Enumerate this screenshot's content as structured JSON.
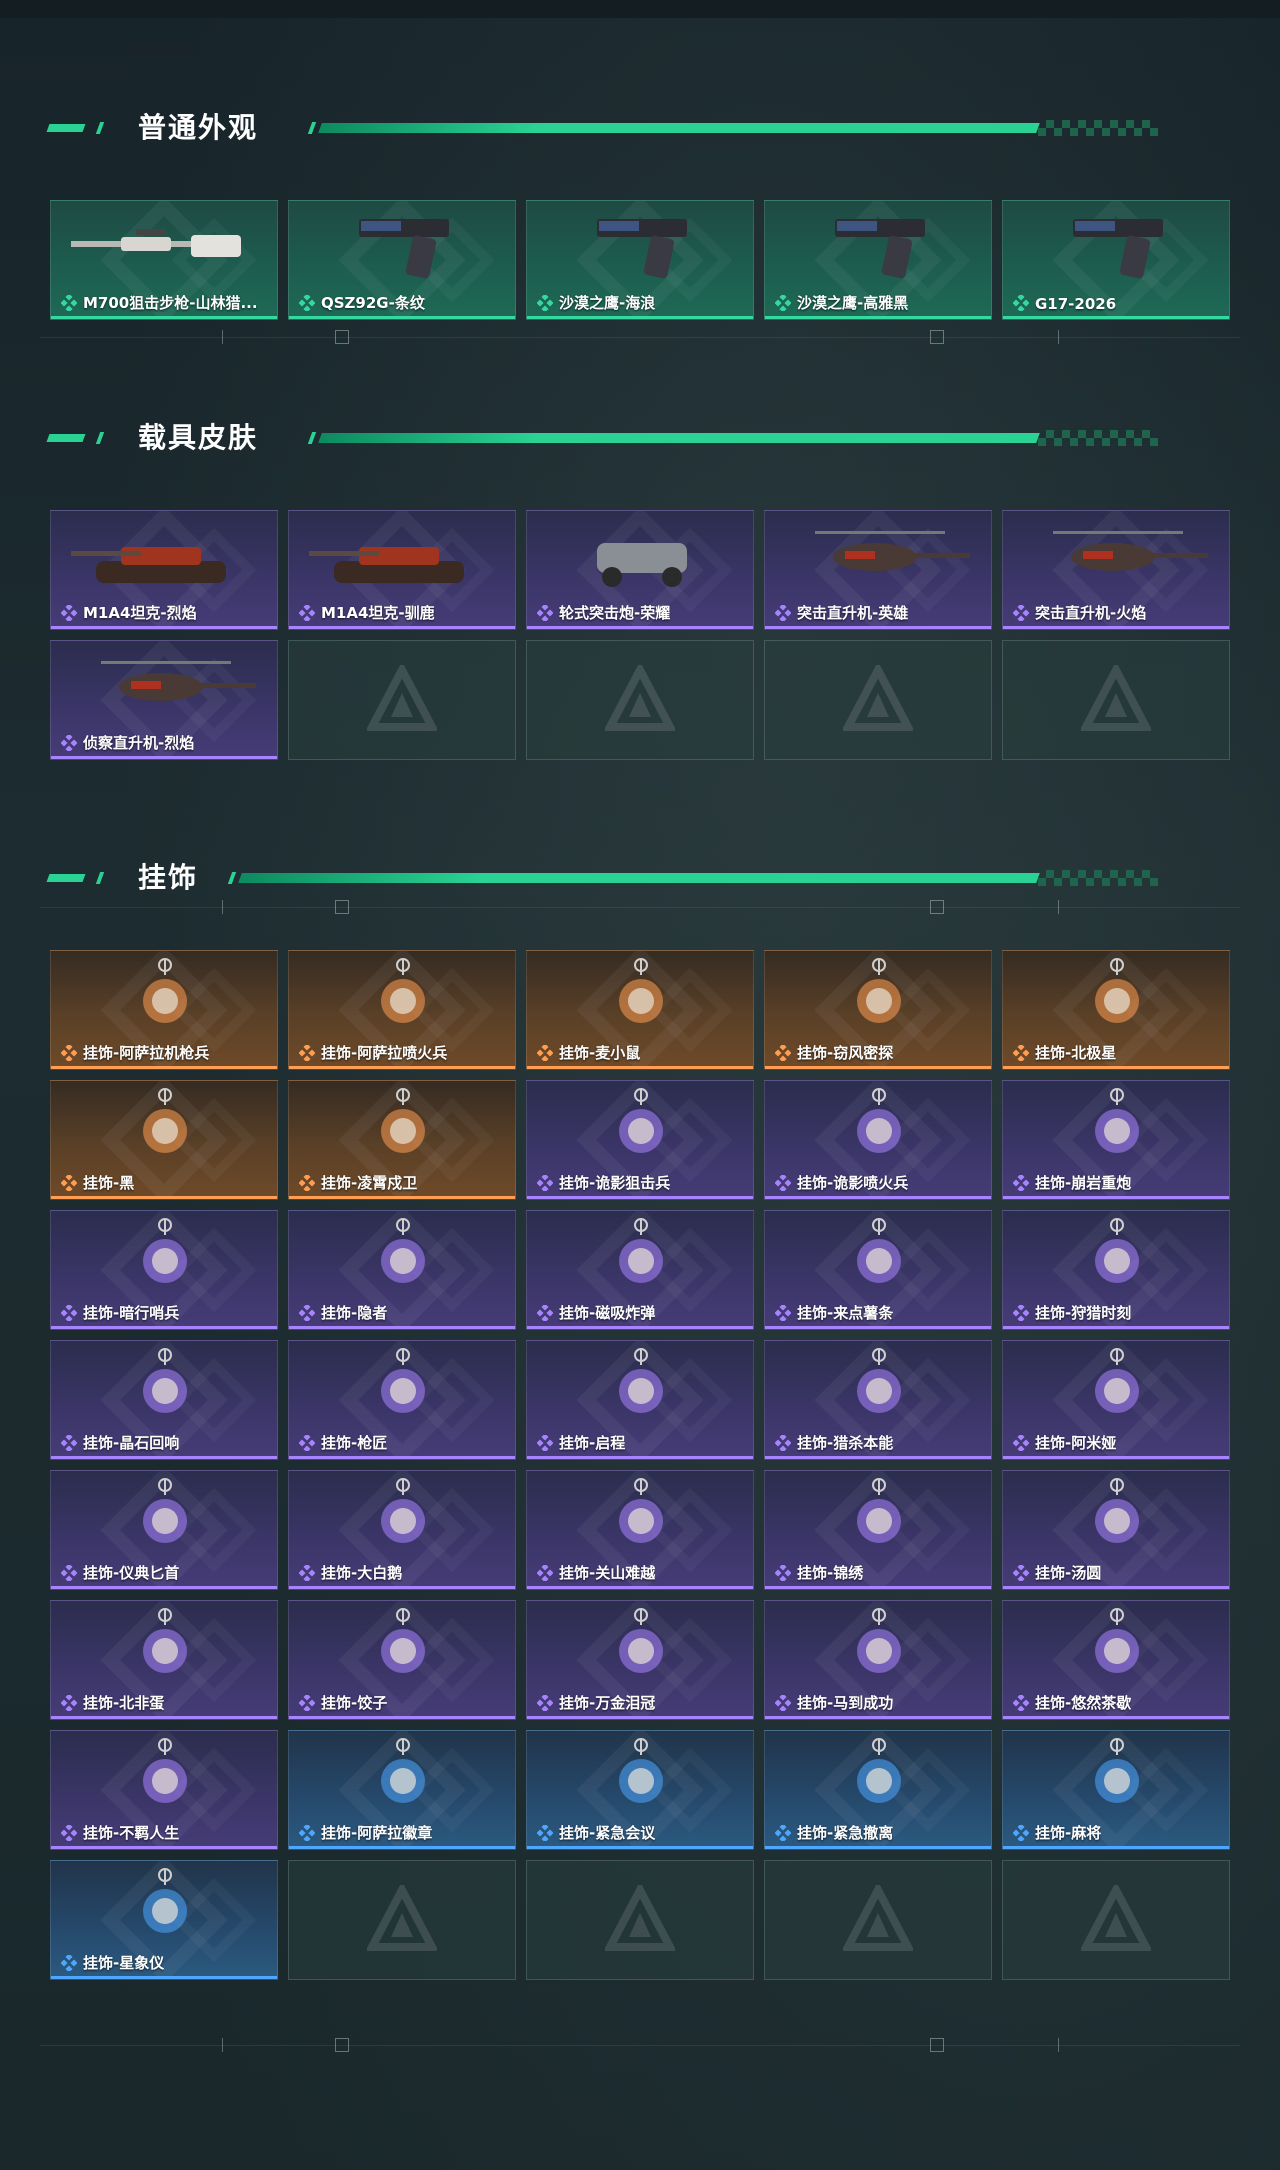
{
  "sections": [
    {
      "title": "普通外观",
      "items": [
        {
          "label": "M700狙击步枪-山林猎...",
          "rarity": "green",
          "icon": "sniper-rifle-icon"
        },
        {
          "label": "QSZ92G-条纹",
          "rarity": "green",
          "icon": "pistol-icon"
        },
        {
          "label": "沙漠之鹰-海浪",
          "rarity": "green",
          "icon": "pistol-icon"
        },
        {
          "label": "沙漠之鹰-高雅黑",
          "rarity": "green",
          "icon": "pistol-icon"
        },
        {
          "label": "G17-2026",
          "rarity": "green",
          "icon": "pistol-icon"
        }
      ]
    },
    {
      "title": "载具皮肤",
      "items": [
        {
          "label": "M1A4坦克-烈焰",
          "rarity": "purple",
          "icon": "tank-icon"
        },
        {
          "label": "M1A4坦克-驯鹿",
          "rarity": "purple",
          "icon": "tank-icon"
        },
        {
          "label": "轮式突击炮-荣耀",
          "rarity": "purple",
          "icon": "armored-car-icon"
        },
        {
          "label": "突击直升机-英雄",
          "rarity": "purple",
          "icon": "helicopter-icon"
        },
        {
          "label": "突击直升机-火焰",
          "rarity": "purple",
          "icon": "helicopter-icon"
        },
        {
          "label": "侦察直升机-烈焰",
          "rarity": "purple",
          "icon": "helicopter-icon"
        },
        {
          "label": "",
          "rarity": "empty"
        },
        {
          "label": "",
          "rarity": "empty"
        },
        {
          "label": "",
          "rarity": "empty"
        },
        {
          "label": "",
          "rarity": "empty"
        }
      ]
    },
    {
      "title": "挂饰",
      "items": [
        {
          "label": "挂饰-阿萨拉机枪兵",
          "rarity": "orange"
        },
        {
          "label": "挂饰-阿萨拉喷火兵",
          "rarity": "orange"
        },
        {
          "label": "挂饰-麦小鼠",
          "rarity": "orange"
        },
        {
          "label": "挂饰-窃风密探",
          "rarity": "orange"
        },
        {
          "label": "挂饰-北极星",
          "rarity": "orange"
        },
        {
          "label": "挂饰-黑",
          "rarity": "orange"
        },
        {
          "label": "挂饰-凌霄戍卫",
          "rarity": "orange"
        },
        {
          "label": "挂饰-诡影狙击兵",
          "rarity": "purple"
        },
        {
          "label": "挂饰-诡影喷火兵",
          "rarity": "purple"
        },
        {
          "label": "挂饰-崩岩重炮",
          "rarity": "purple"
        },
        {
          "label": "挂饰-暗行哨兵",
          "rarity": "purple"
        },
        {
          "label": "挂饰-隐者",
          "rarity": "purple"
        },
        {
          "label": "挂饰-磁吸炸弹",
          "rarity": "purple"
        },
        {
          "label": "挂饰-来点薯条",
          "rarity": "purple"
        },
        {
          "label": "挂饰-狩猎时刻",
          "rarity": "purple"
        },
        {
          "label": "挂饰-晶石回响",
          "rarity": "purple"
        },
        {
          "label": "挂饰-枪匠",
          "rarity": "purple"
        },
        {
          "label": "挂饰-启程",
          "rarity": "purple"
        },
        {
          "label": "挂饰-猎杀本能",
          "rarity": "purple"
        },
        {
          "label": "挂饰-阿米娅",
          "rarity": "purple"
        },
        {
          "label": "挂饰-仪典匕首",
          "rarity": "purple"
        },
        {
          "label": "挂饰-大白鹅",
          "rarity": "purple"
        },
        {
          "label": "挂饰-关山难越",
          "rarity": "purple"
        },
        {
          "label": "挂饰-锦绣",
          "rarity": "purple"
        },
        {
          "label": "挂饰-汤圆",
          "rarity": "purple"
        },
        {
          "label": "挂饰-北非蛋",
          "rarity": "purple"
        },
        {
          "label": "挂饰-饺子",
          "rarity": "purple"
        },
        {
          "label": "挂饰-万金泪冠",
          "rarity": "purple"
        },
        {
          "label": "挂饰-马到成功",
          "rarity": "purple"
        },
        {
          "label": "挂饰-悠然茶歇",
          "rarity": "purple"
        },
        {
          "label": "挂饰-不羁人生",
          "rarity": "purple"
        },
        {
          "label": "挂饰-阿萨拉徽章",
          "rarity": "blue"
        },
        {
          "label": "挂饰-紧急会议",
          "rarity": "blue"
        },
        {
          "label": "挂饰-紧急撤离",
          "rarity": "blue"
        },
        {
          "label": "挂饰-麻将",
          "rarity": "blue"
        },
        {
          "label": "挂饰-星象仪",
          "rarity": "blue"
        },
        {
          "label": "",
          "rarity": "empty"
        },
        {
          "label": "",
          "rarity": "empty"
        },
        {
          "label": "",
          "rarity": "empty"
        },
        {
          "label": "",
          "rarity": "empty"
        }
      ]
    }
  ],
  "colors": {
    "accent": "#2ad293",
    "green": "#35d9a0",
    "purple": "#a883ff",
    "orange": "#ff9d52",
    "blue": "#4fa6ff"
  }
}
